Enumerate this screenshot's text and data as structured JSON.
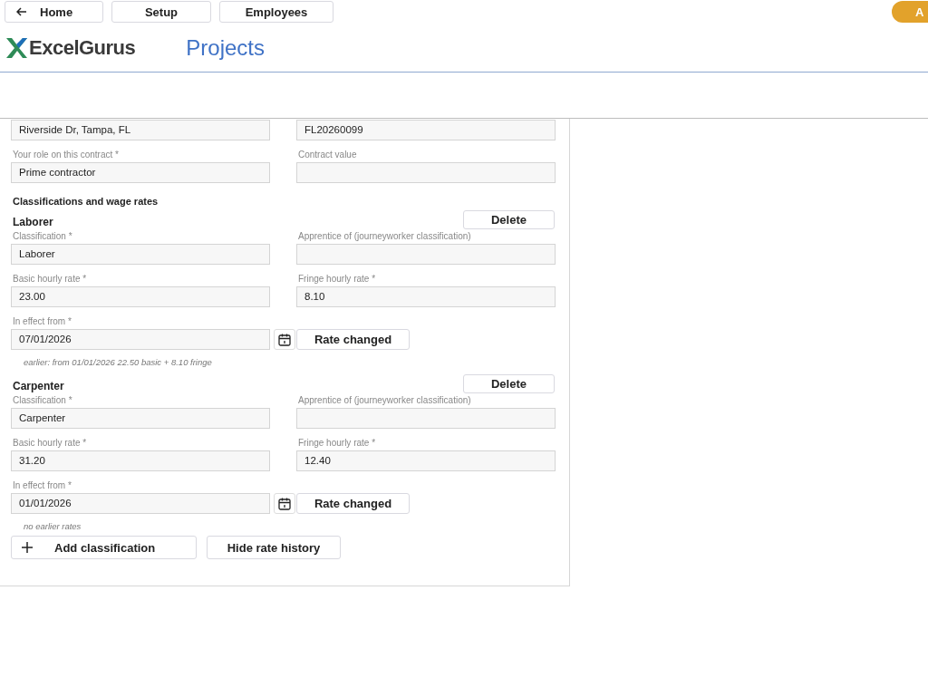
{
  "nav": {
    "buttons": [
      {
        "label": "Home",
        "kind": "back"
      },
      {
        "label": "Setup",
        "kind": "plain"
      },
      {
        "label": "Employees",
        "kind": "plain"
      }
    ]
  },
  "account_button": {
    "label": "A"
  },
  "brand": {
    "name": "ExcelGurus"
  },
  "page_title": "Projects",
  "form": {
    "rows": [
      [
        {
          "value": "Riverside Dr, Tampa, FL"
        },
        {
          "value": "FL20260099"
        }
      ],
      [
        {
          "label": "Your role on this contract *",
          "value": "Prime contractor"
        },
        {
          "label": "Contract value"
        }
      ]
    ],
    "classifications_title": "Classifications and wage rates",
    "classifications": [
      {
        "name": "Laborer",
        "delete_label": "Delete",
        "fields": [
          [
            {
              "label": "Classification *",
              "value": "Laborer"
            },
            {
              "label": "Apprentice of (journeyworker classification)"
            }
          ],
          [
            {
              "label": "Basic hourly rate *",
              "value": "23.00"
            },
            {
              "label": "Fringe hourly rate *",
              "value": "8.10"
            }
          ]
        ],
        "effective": {
          "label": "In effect from *",
          "value": "07/01/2026"
        },
        "rate_changed_label": "Rate changed",
        "history": "earlier: from 01/01/2026   22.50 basic + 8.10 fringe"
      },
      {
        "name": "Carpenter",
        "delete_label": "Delete",
        "fields": [
          [
            {
              "label": "Classification *",
              "value": "Carpenter"
            },
            {
              "label": "Apprentice of (journeyworker classification)"
            }
          ],
          [
            {
              "label": "Basic hourly rate *",
              "value": "31.20"
            },
            {
              "label": "Fringe hourly rate *",
              "value": "12.40"
            }
          ]
        ],
        "effective": {
          "label": "In effect from *",
          "value": "01/01/2026"
        },
        "rate_changed_label": "Rate changed",
        "history": "no earlier rates"
      }
    ],
    "add_label": "Add classification",
    "hide_history_label": "Hide rate history"
  }
}
